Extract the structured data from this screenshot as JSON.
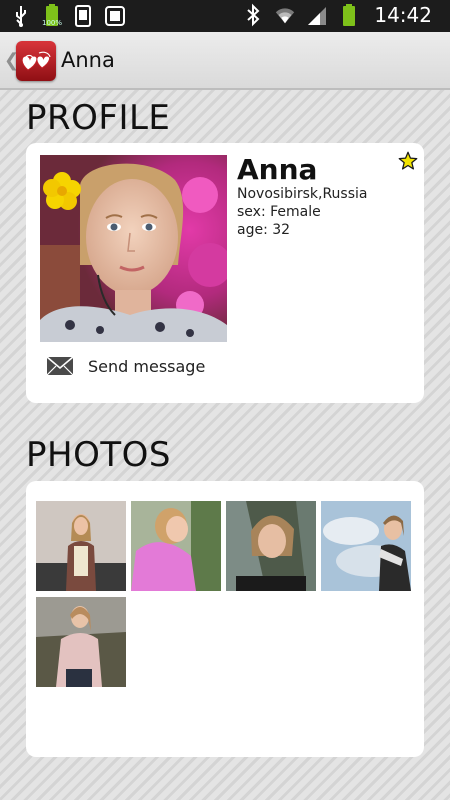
{
  "status_bar": {
    "time": "14:42",
    "battery_label": "100%",
    "icons": [
      "usb-icon",
      "battery-small-icon",
      "phone-icon",
      "screenshot-icon",
      "bluetooth-icon",
      "wifi-icon",
      "signal-icon",
      "battery-icon"
    ]
  },
  "action_bar": {
    "title": "Anna",
    "app_icon": "hearts-logo"
  },
  "profile": {
    "heading": "PROFILE",
    "name": "Anna",
    "location": "Novosibirsk,Russia",
    "sex": "sex: Female",
    "age": "age: 32",
    "send_message": "Send message",
    "favorite_icon": "star-icon"
  },
  "photos": {
    "heading": "PHOTOS",
    "count": 5
  },
  "colors": {
    "accent_red": "#c62027",
    "star_yellow": "#f2e400"
  }
}
